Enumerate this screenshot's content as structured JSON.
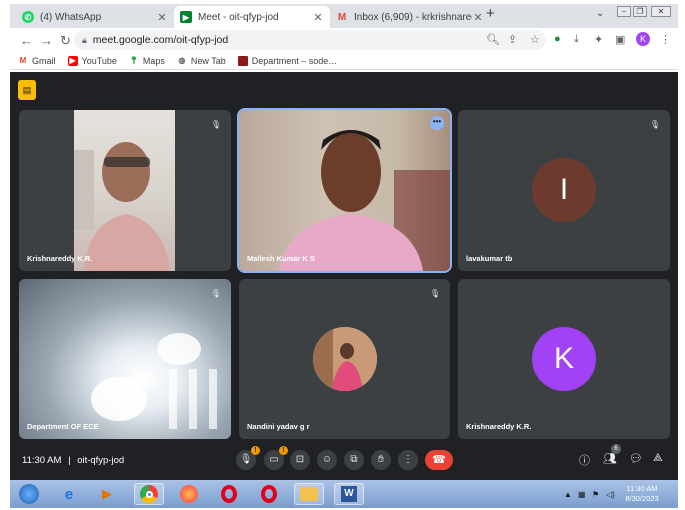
{
  "browser": {
    "tabs": [
      {
        "label": "(4) WhatsApp",
        "active": false
      },
      {
        "label": "Meet - oit-qfyp-jod",
        "active": true
      },
      {
        "label": "Inbox (6,909) - krkrishnareddy6…",
        "active": false
      }
    ],
    "url": "meet.google.com/oit-qfyp-jod",
    "profile_initial": "K",
    "bookmarks": [
      "Gmail",
      "YouTube",
      "Maps",
      "New Tab",
      "Department – sode…"
    ]
  },
  "meet": {
    "time": "11:30 AM",
    "separator": "|",
    "code": "oit-qfyp-jod",
    "people_count": "6",
    "participants": [
      {
        "name": "Krishnareddy K.R.",
        "type": "video",
        "muted": true
      },
      {
        "name": "Mallesh Kumar K S",
        "type": "video",
        "muted": false,
        "speaking": true
      },
      {
        "name": "lavakumar tb",
        "type": "avatar",
        "initial": "I",
        "color": "#6d3b2e",
        "muted": true
      },
      {
        "name": "Department OF ECE",
        "type": "video",
        "muted": true
      },
      {
        "name": "Nandini yadav g r",
        "type": "photo",
        "muted": true
      },
      {
        "name": "Krishnareddy K.R.",
        "type": "avatar",
        "initial": "K",
        "color": "#a142f4",
        "muted": false
      }
    ],
    "warning_badge": "!"
  },
  "taskbar": {
    "time": "11:30 AM",
    "date": "8/30/2023"
  },
  "colors": {
    "meet_bg": "#202124",
    "tile_bg": "#3c4043",
    "end_call": "#ea4335",
    "speaking_outline": "#8ab4f8"
  }
}
